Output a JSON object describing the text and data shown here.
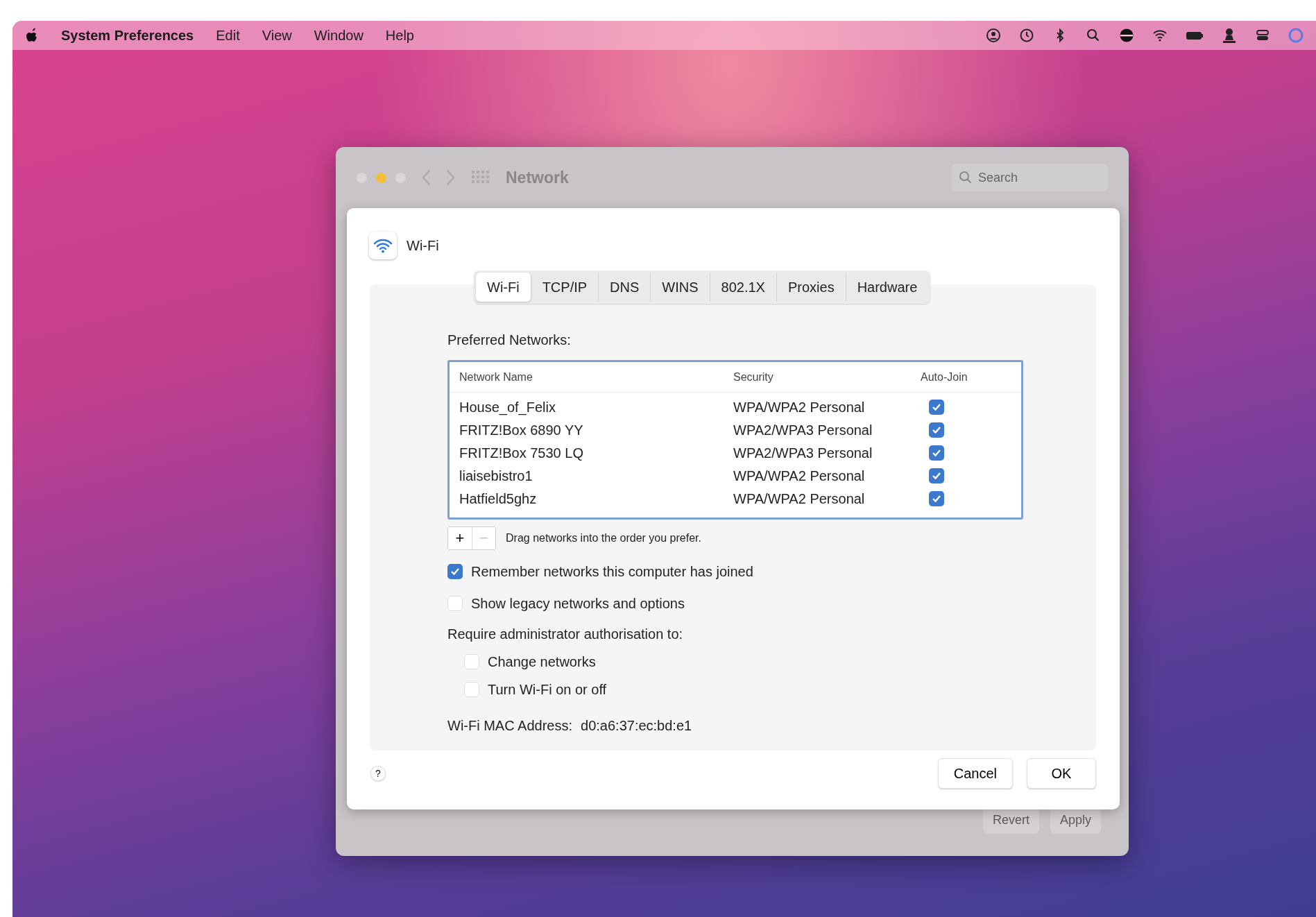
{
  "menu_bar": {
    "app": "System Preferences",
    "menus": [
      "Edit",
      "View",
      "Window",
      "Help"
    ]
  },
  "window": {
    "title": "Network",
    "search": {
      "placeholder": "Search"
    },
    "footer_buttons": [
      "Revert",
      "Apply"
    ]
  },
  "sheet": {
    "title": "Wi-Fi",
    "tabs": [
      {
        "label": "Wi-Fi",
        "selected": true
      },
      {
        "label": "TCP/IP",
        "selected": false
      },
      {
        "label": "DNS",
        "selected": false
      },
      {
        "label": "WINS",
        "selected": false
      },
      {
        "label": "802.1X",
        "selected": false
      },
      {
        "label": "Proxies",
        "selected": false
      },
      {
        "label": "Hardware",
        "selected": false
      }
    ],
    "preferred_label": "Preferred Networks:",
    "table": {
      "columns": [
        "Network Name",
        "Security",
        "Auto-Join"
      ],
      "rows": [
        {
          "name": "House_of_Felix",
          "security": "WPA/WPA2 Personal",
          "auto_join": true
        },
        {
          "name": "FRITZ!Box 6890 YY",
          "security": "WPA2/WPA3 Personal",
          "auto_join": true
        },
        {
          "name": "FRITZ!Box 7530 LQ",
          "security": "WPA2/WPA3 Personal",
          "auto_join": true
        },
        {
          "name": "liaisebistro1",
          "security": "WPA/WPA2 Personal",
          "auto_join": true
        },
        {
          "name": "Hatfield5ghz",
          "security": "WPA/WPA2 Personal",
          "auto_join": true
        }
      ]
    },
    "add_button": {
      "label": "+",
      "disabled": false
    },
    "remove_button": {
      "label": "−",
      "disabled": true
    },
    "drag_hint": "Drag networks into the order you prefer.",
    "options": [
      {
        "label": "Remember networks this computer has joined",
        "checked": true
      },
      {
        "label": "Show legacy networks and options",
        "checked": false
      }
    ],
    "admin_label": "Require administrator authorisation to:",
    "admin_options": [
      {
        "label": "Change networks",
        "checked": false
      },
      {
        "label": "Turn Wi-Fi on or off",
        "checked": false
      }
    ],
    "mac_label": "Wi-Fi MAC Address:",
    "mac_value": "d0:a6:37:ec:bd:e1",
    "help": "?",
    "buttons": [
      "Cancel",
      "OK"
    ]
  }
}
